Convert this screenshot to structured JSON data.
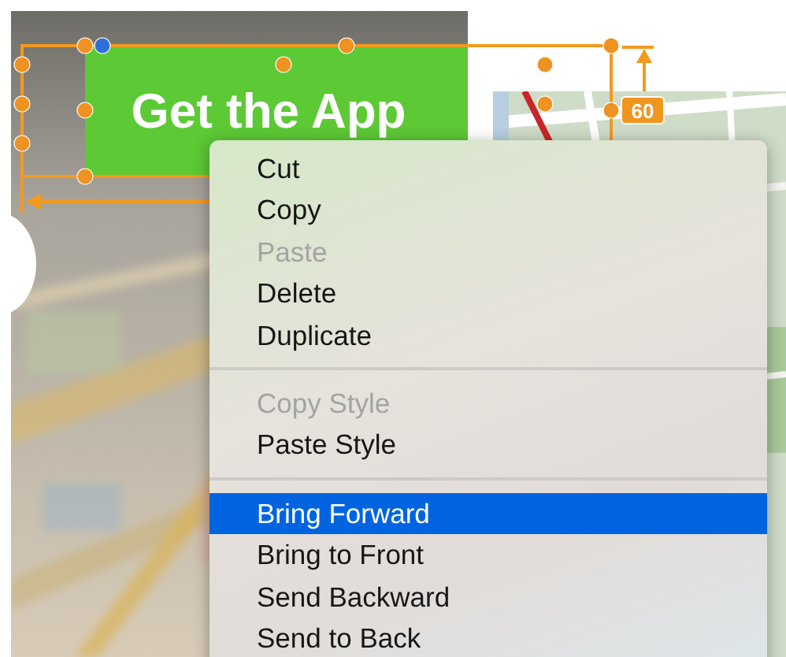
{
  "canvas": {
    "button_label": "Get the App",
    "spacing_badge": "60"
  },
  "context_menu": {
    "items": [
      {
        "kind": "item",
        "label": "Cut",
        "disabled": false,
        "selected": false
      },
      {
        "kind": "item",
        "label": "Copy",
        "disabled": false,
        "selected": false
      },
      {
        "kind": "item",
        "label": "Paste",
        "disabled": true,
        "selected": false
      },
      {
        "kind": "item",
        "label": "Delete",
        "disabled": false,
        "selected": false
      },
      {
        "kind": "item",
        "label": "Duplicate",
        "disabled": false,
        "selected": false
      },
      {
        "kind": "separator"
      },
      {
        "kind": "item",
        "label": "Copy Style",
        "disabled": true,
        "selected": false
      },
      {
        "kind": "item",
        "label": "Paste Style",
        "disabled": false,
        "selected": false
      },
      {
        "kind": "separator"
      },
      {
        "kind": "item",
        "label": "Bring Forward",
        "disabled": false,
        "selected": true
      },
      {
        "kind": "item",
        "label": "Bring to Front",
        "disabled": false,
        "selected": false
      },
      {
        "kind": "item",
        "label": "Send Backward",
        "disabled": false,
        "selected": false
      },
      {
        "kind": "item",
        "label": "Send to Back",
        "disabled": false,
        "selected": false
      }
    ]
  }
}
